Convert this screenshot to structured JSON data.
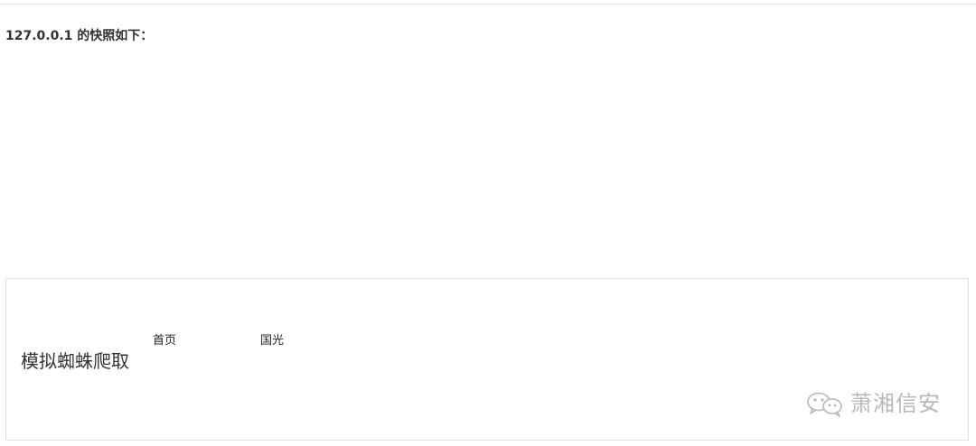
{
  "heading": "127.0.0.1 的快照如下：",
  "snapshot": {
    "site_title": "模拟蜘蛛爬取",
    "nav": {
      "home": "首页",
      "guoguang": "国光"
    }
  },
  "watermark": {
    "icon": "wechat-icon",
    "text": "萧湘信安"
  }
}
